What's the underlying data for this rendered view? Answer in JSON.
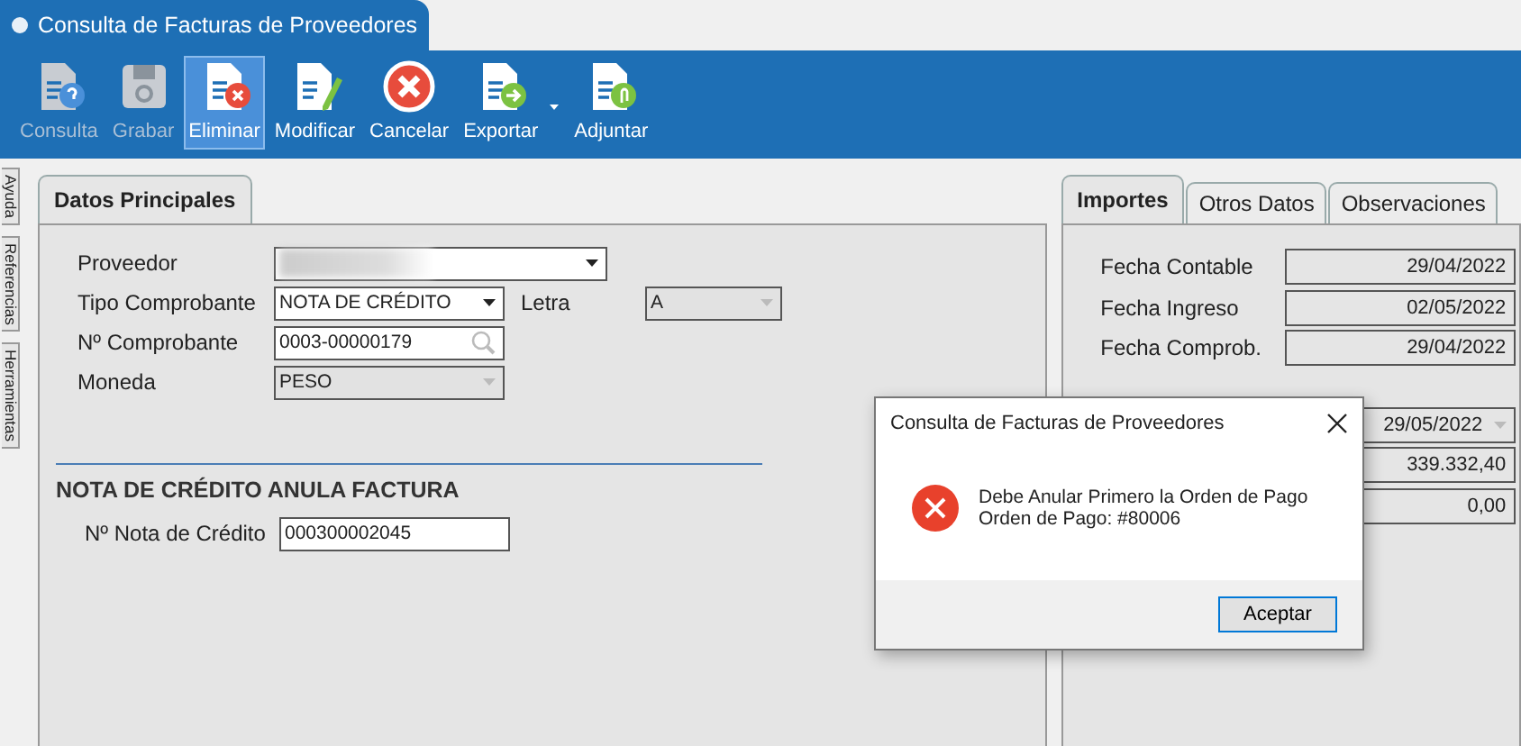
{
  "window": {
    "title": "Consulta de Facturas de Proveedores"
  },
  "toolbar": [
    {
      "label": "Consulta",
      "kind": "query",
      "disabled": true,
      "selected": false,
      "dropdown": false
    },
    {
      "label": "Grabar",
      "kind": "save",
      "disabled": true,
      "selected": false,
      "dropdown": false
    },
    {
      "label": "Eliminar",
      "kind": "delete",
      "disabled": false,
      "selected": true,
      "dropdown": false
    },
    {
      "label": "Modificar",
      "kind": "edit",
      "disabled": false,
      "selected": false,
      "dropdown": false
    },
    {
      "label": "Cancelar",
      "kind": "cancel",
      "disabled": false,
      "selected": false,
      "dropdown": false
    },
    {
      "label": "Exportar",
      "kind": "export",
      "disabled": false,
      "selected": false,
      "dropdown": true
    },
    {
      "label": "Adjuntar",
      "kind": "attach",
      "disabled": false,
      "selected": false,
      "dropdown": false
    }
  ],
  "side_tabs": [
    {
      "label": "Ayuda"
    },
    {
      "label": "Referencias"
    },
    {
      "label": "Herramientas"
    }
  ],
  "main_tabs": [
    {
      "label": "Datos Principales",
      "selected": true
    }
  ],
  "form": {
    "proveedor": {
      "label": "Proveedor",
      "blurred": true
    },
    "tipo": {
      "label": "Tipo Comprobante",
      "value": "NOTA DE CRÉDITO",
      "disabled": false
    },
    "letra": {
      "label": "Letra",
      "value": "A",
      "disabled": true
    },
    "comprobante": {
      "label": "Nº Comprobante",
      "value": "0003-00000179"
    },
    "moneda": {
      "label": "Moneda",
      "value": "PESO",
      "disabled": true
    },
    "section": {
      "title": "NOTA DE CRÉDITO ANULA FACTURA"
    },
    "nota": {
      "label": "Nº Nota de Crédito",
      "value": "000300002045"
    }
  },
  "right_tabs": [
    {
      "label": "Importes",
      "selected": true
    },
    {
      "label": "Otros Datos",
      "selected": false
    },
    {
      "label": "Observaciones",
      "selected": false
    }
  ],
  "dates": [
    {
      "label": "Fecha Contable",
      "value": "29/04/2022"
    },
    {
      "label": "Fecha Ingreso",
      "value": "02/05/2022"
    },
    {
      "label": "Fecha Comprob.",
      "value": "29/04/2022"
    }
  ],
  "amounts": [
    {
      "value": "29/05/2022",
      "kind": "dropdown"
    },
    {
      "value": "339.332,40",
      "kind": "text"
    },
    {
      "value": "0,00",
      "kind": "text"
    }
  ],
  "dialog": {
    "title": "Consulta de Facturas de Proveedores",
    "message": [
      "Debe Anular Primero la Orden de Pago",
      "Orden de Pago: #80006"
    ],
    "button": "Aceptar"
  }
}
